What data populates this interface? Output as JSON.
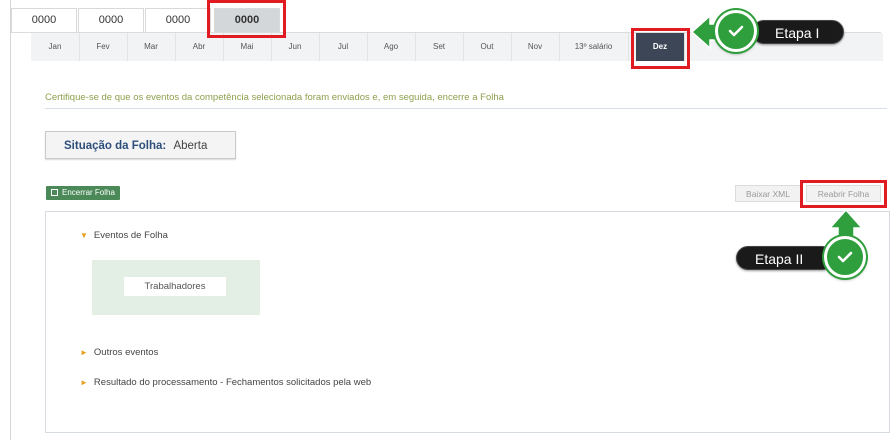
{
  "year_tabs": [
    "0000",
    "0000",
    "0000",
    "0000"
  ],
  "months": [
    "Jan",
    "Fev",
    "Mar",
    "Abr",
    "Mai",
    "Jun",
    "Jul",
    "Ago",
    "Set",
    "Out",
    "Nov",
    "13º salário",
    "Dez"
  ],
  "instruction": "Certifique-se de que os eventos da competência selecionada foram enviados e, em seguida, encerre a Folha",
  "status": {
    "label": "Situação da Folha:",
    "value": "Aberta"
  },
  "buttons": {
    "encerrar": "Encerrar Folha",
    "baixar_xml": "Baixar XML",
    "reabrir": "Reabrir Folha"
  },
  "tree": {
    "eventos_folha": "Eventos de Folha",
    "trabalhadores": "Trabalhadores",
    "outros_eventos": "Outros eventos",
    "resultado": "Resultado do processamento - Fechamentos solicitados pela web"
  },
  "annotations": {
    "etapa1": "Etapa I",
    "etapa2": "Etapa II"
  },
  "colors": {
    "accent_red": "#e11b22",
    "check_green": "#2f9e3c",
    "selected_month": "#3d4657",
    "encerrar_green": "#4b8a58"
  }
}
